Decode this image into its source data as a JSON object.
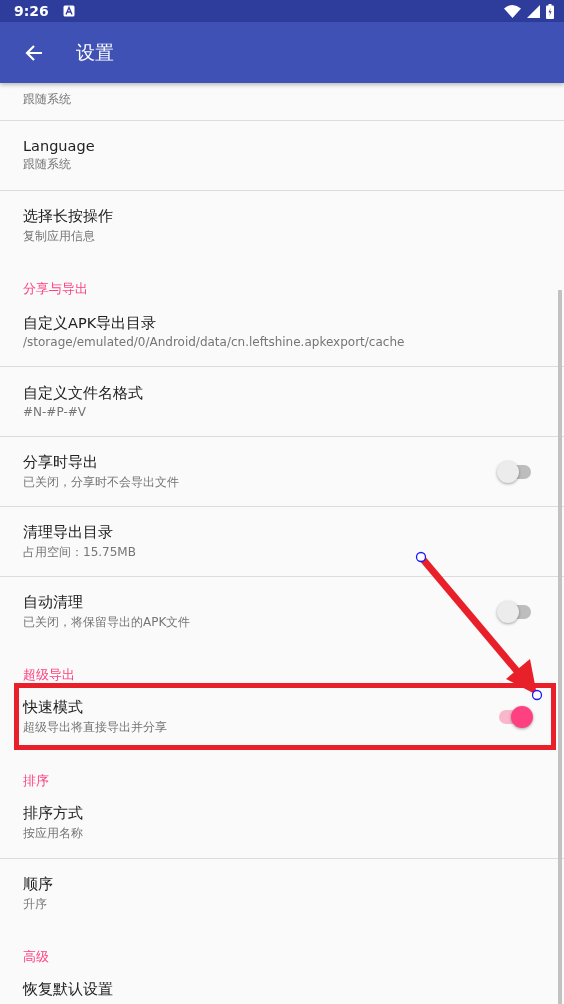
{
  "status_bar": {
    "time": "9:26"
  },
  "app_bar": {
    "title": "设置"
  },
  "settings": [
    {
      "kind": "partial",
      "summary": "跟随系统",
      "annotated": false
    },
    {
      "kind": "item",
      "title": "Language",
      "summary": "跟随系统",
      "annotated": false
    },
    {
      "kind": "item",
      "title": "选择长按操作",
      "summary": "复制应用信息",
      "annotated": false
    },
    {
      "kind": "category",
      "title": "分享与导出"
    },
    {
      "kind": "item",
      "title": "自定义APK导出目录",
      "summary": "/storage/emulated/0/Android/data/cn.leftshine.apkexport/cache",
      "annotated": false
    },
    {
      "kind": "item",
      "title": "自定义文件名格式",
      "summary": "#N-#P-#V",
      "annotated": false
    },
    {
      "kind": "switch",
      "title": "分享时导出",
      "summary": "已关闭，分享时不会导出文件",
      "on": false,
      "annotated": false
    },
    {
      "kind": "item",
      "title": "清理导出目录",
      "summary": "占用空间：15.75MB",
      "annotated": false
    },
    {
      "kind": "switch",
      "title": "自动清理",
      "summary": "已关闭，将保留导出的APK文件",
      "on": false,
      "annotated": false
    },
    {
      "kind": "category",
      "title": "超级导出"
    },
    {
      "kind": "switch",
      "title": "快速模式",
      "summary": "超级导出将直接导出并分享",
      "on": true,
      "annotated": true
    },
    {
      "kind": "category",
      "title": "排序"
    },
    {
      "kind": "item",
      "title": "排序方式",
      "summary": "按应用名称",
      "annotated": false
    },
    {
      "kind": "item",
      "title": "顺序",
      "summary": "升序",
      "annotated": false
    },
    {
      "kind": "category",
      "title": "高级"
    },
    {
      "kind": "item",
      "title": "恢复默认设置",
      "annotated": false
    }
  ]
}
